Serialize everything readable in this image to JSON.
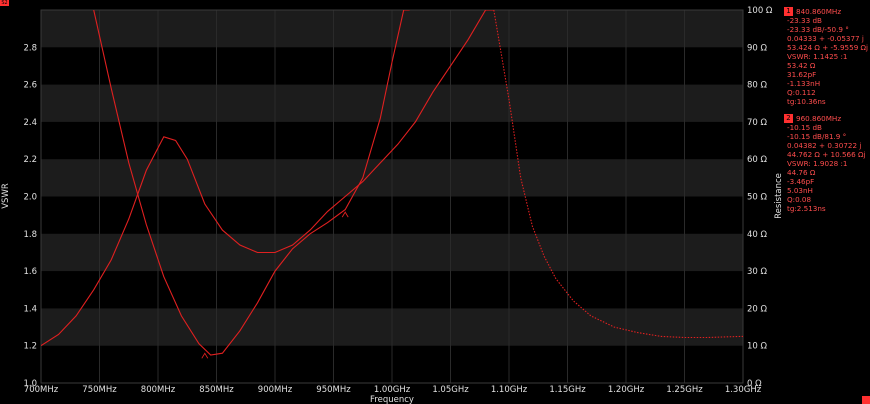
{
  "trace_badge": "S2",
  "colors": {
    "background": "#000000",
    "band": "#1c1c1c",
    "trace": "#e02020",
    "text": "#e0e0e0",
    "marker": "#ff3030"
  },
  "chart_data": {
    "type": "line",
    "xlabel": "Frequency",
    "ylabel_left": "VSWR",
    "ylabel_right": "Resistance",
    "xlim_mhz": [
      700,
      1300
    ],
    "ylim_left": [
      1.0,
      3.0
    ],
    "ylim_right": [
      0,
      100
    ],
    "x_tick_labels": [
      "700MHz",
      "750MHz",
      "800MHz",
      "850MHz",
      "900MHz",
      "950MHz",
      "1.00GHz",
      "1.05GHz",
      "1.10GHz",
      "1.15GHz",
      "1.20GHz",
      "1.25GHz",
      "1.30GHz"
    ],
    "y_left_tick_labels": [
      "1.0",
      "1.2",
      "1.4",
      "1.6",
      "1.8",
      "2.0",
      "2.2",
      "2.4",
      "2.6",
      "2.8"
    ],
    "y_right_tick_labels": [
      "0 Ω",
      "10 Ω",
      "20 Ω",
      "30 Ω",
      "40 Ω",
      "50 Ω",
      "60 Ω",
      "70 Ω",
      "80 Ω",
      "90 Ω",
      "100 Ω"
    ],
    "series": [
      {
        "axis": "left",
        "x": [
          745,
          760,
          775,
          790,
          805,
          820,
          835,
          845,
          855,
          870,
          885,
          900,
          915,
          930,
          945,
          960,
          975,
          990,
          1000,
          1010,
          1015
        ],
        "y": [
          3.0,
          2.58,
          2.18,
          1.85,
          1.57,
          1.36,
          1.21,
          1.15,
          1.16,
          1.28,
          1.43,
          1.6,
          1.72,
          1.8,
          1.86,
          1.93,
          2.1,
          2.42,
          2.72,
          3.0,
          3.0
        ]
      },
      {
        "axis": "right",
        "x": [
          700,
          715,
          730,
          745,
          760,
          775,
          790,
          805,
          815,
          825,
          840,
          855,
          870,
          885,
          900,
          915,
          930,
          945,
          960,
          975,
          990,
          1005,
          1020,
          1035,
          1050,
          1065,
          1080,
          1087
        ],
        "y": [
          10,
          13,
          18,
          25,
          33,
          44,
          57,
          66,
          65,
          60,
          48,
          41,
          37,
          35,
          35,
          37,
          41,
          46,
          50,
          54,
          59,
          64,
          70,
          78,
          85,
          92,
          100,
          100
        ]
      },
      {
        "axis": "right",
        "x": [
          1087,
          1100,
          1110,
          1120,
          1130,
          1140,
          1155,
          1170,
          1190,
          1210,
          1230,
          1250,
          1270,
          1290,
          1300
        ],
        "y": [
          100,
          76,
          55,
          42,
          34,
          28,
          22,
          18,
          15,
          13.5,
          12.5,
          12.2,
          12.2,
          12.4,
          12.5
        ]
      }
    ],
    "markers": [
      {
        "number": "1",
        "freq_mhz": 840,
        "vswr": 1.143,
        "lines": [
          "840.860MHz",
          "-23.33 dB",
          "-23.33 dB/-50.9 °",
          "0.04333 + -0.05377 j",
          "53.424 Ω + -5.9559 Ωj",
          "VSWR: 1.1425 :1",
          "53.42 Ω",
          "31.62pF",
          "-1.133nH",
          "Q:0.112",
          "tg:10.36ns"
        ]
      },
      {
        "number": "2",
        "freq_mhz": 960,
        "vswr": 1.9,
        "lines": [
          "960.860MHz",
          "-10.15 dB",
          "-10.15 dB/81.9 °",
          "0.04382 + 0.30722 j",
          "44.762 Ω + 10.566 Ωj",
          "VSWR: 1.9028 :1",
          "44.76 Ω",
          "-3.46pF",
          "5.03nH",
          "Q:0.08",
          "tg:2.513ns"
        ]
      }
    ]
  }
}
